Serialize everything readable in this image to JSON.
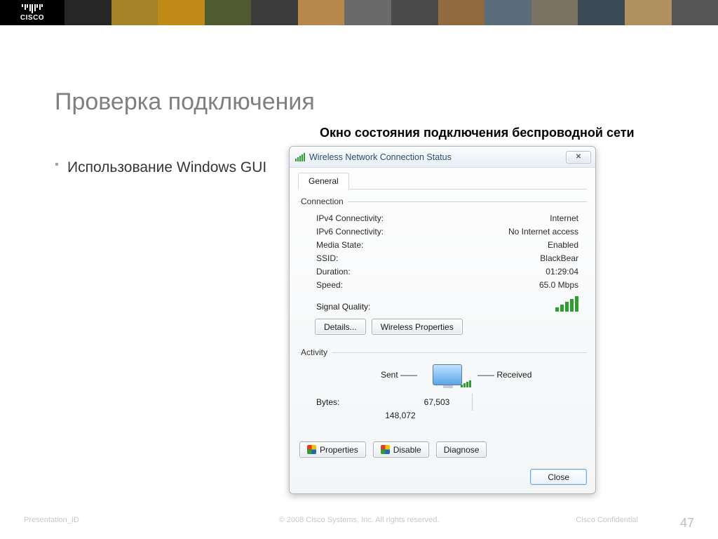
{
  "logo": {
    "text": "cisco"
  },
  "collage_colors": [
    "#262626",
    "#a58329",
    "#c08a17",
    "#4f5a2e",
    "#3b3b3b",
    "#b7884b",
    "#6a6a6a",
    "#4a4a4a",
    "#8f6b3f",
    "#5a6b7a",
    "#7a7362",
    "#3c4a56",
    "#b09060",
    "#555"
  ],
  "slide": {
    "title": "Проверка подключения",
    "subtitle": "Окно состояния подключения беспроводной сети",
    "bullets": [
      "Использование Windows GUI"
    ]
  },
  "dialog": {
    "title": "Wireless Network Connection Status",
    "tab_general": "General",
    "group_connection": "Connection",
    "group_activity": "Activity",
    "rows": {
      "ipv4_label": "IPv4 Connectivity:",
      "ipv4_value": "Internet",
      "ipv6_label": "IPv6 Connectivity:",
      "ipv6_value": "No Internet access",
      "media_label": "Media State:",
      "media_value": "Enabled",
      "ssid_label": "SSID:",
      "ssid_value": "BlackBear",
      "duration_label": "Duration:",
      "duration_value": "01:29:04",
      "speed_label": "Speed:",
      "speed_value": "65.0 Mbps",
      "signal_label": "Signal Quality:"
    },
    "buttons": {
      "details": "Details...",
      "wireless_props": "Wireless Properties",
      "properties": "Properties",
      "disable": "Disable",
      "diagnose": "Diagnose",
      "close": "Close"
    },
    "activity": {
      "sent_label": "Sent",
      "received_label": "Received",
      "bytes_label": "Bytes:",
      "sent_bytes": "67,503",
      "received_bytes": "148,072"
    }
  },
  "footer": {
    "left": "Presentation_ID",
    "center": "© 2008 Cisco Systems, Inc. All rights reserved.",
    "right": "Cisco Confidential",
    "page": "47"
  }
}
